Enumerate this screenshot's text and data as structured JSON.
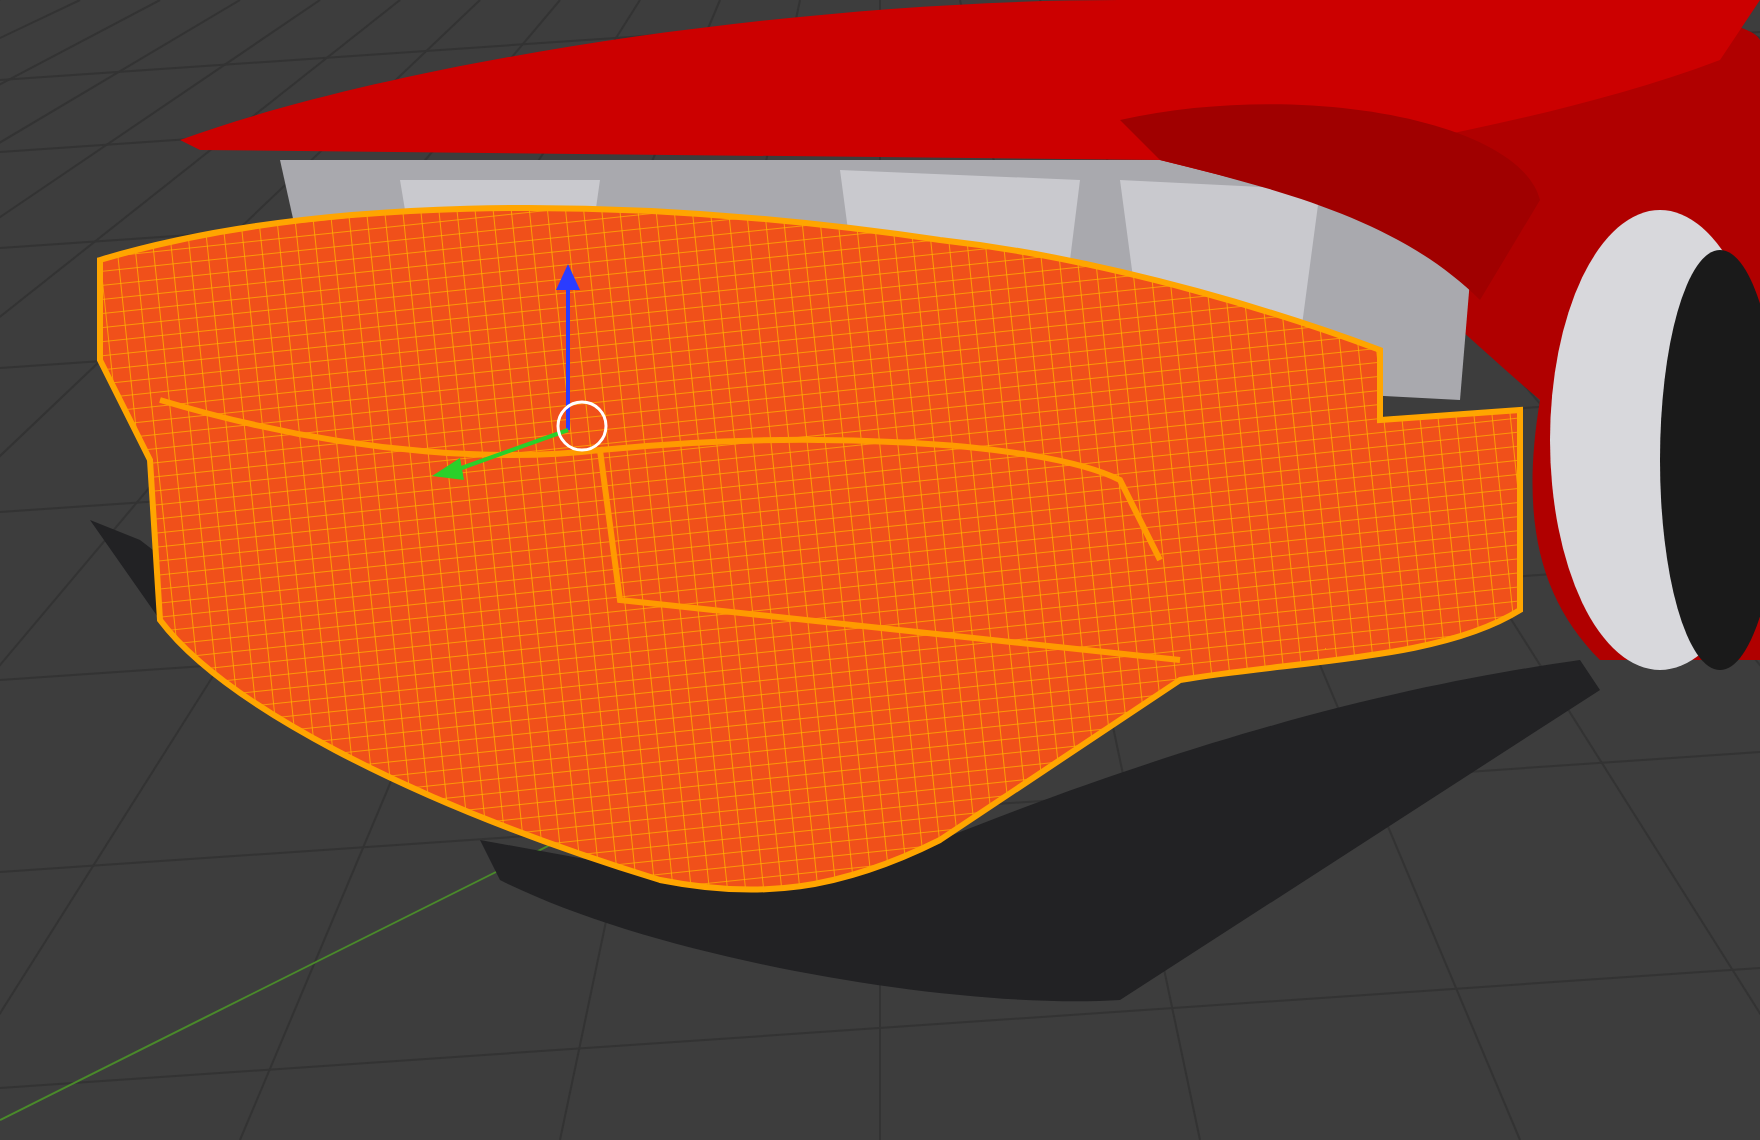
{
  "viewport": {
    "grid": true,
    "gizmo": true,
    "wireframe": true
  }
}
